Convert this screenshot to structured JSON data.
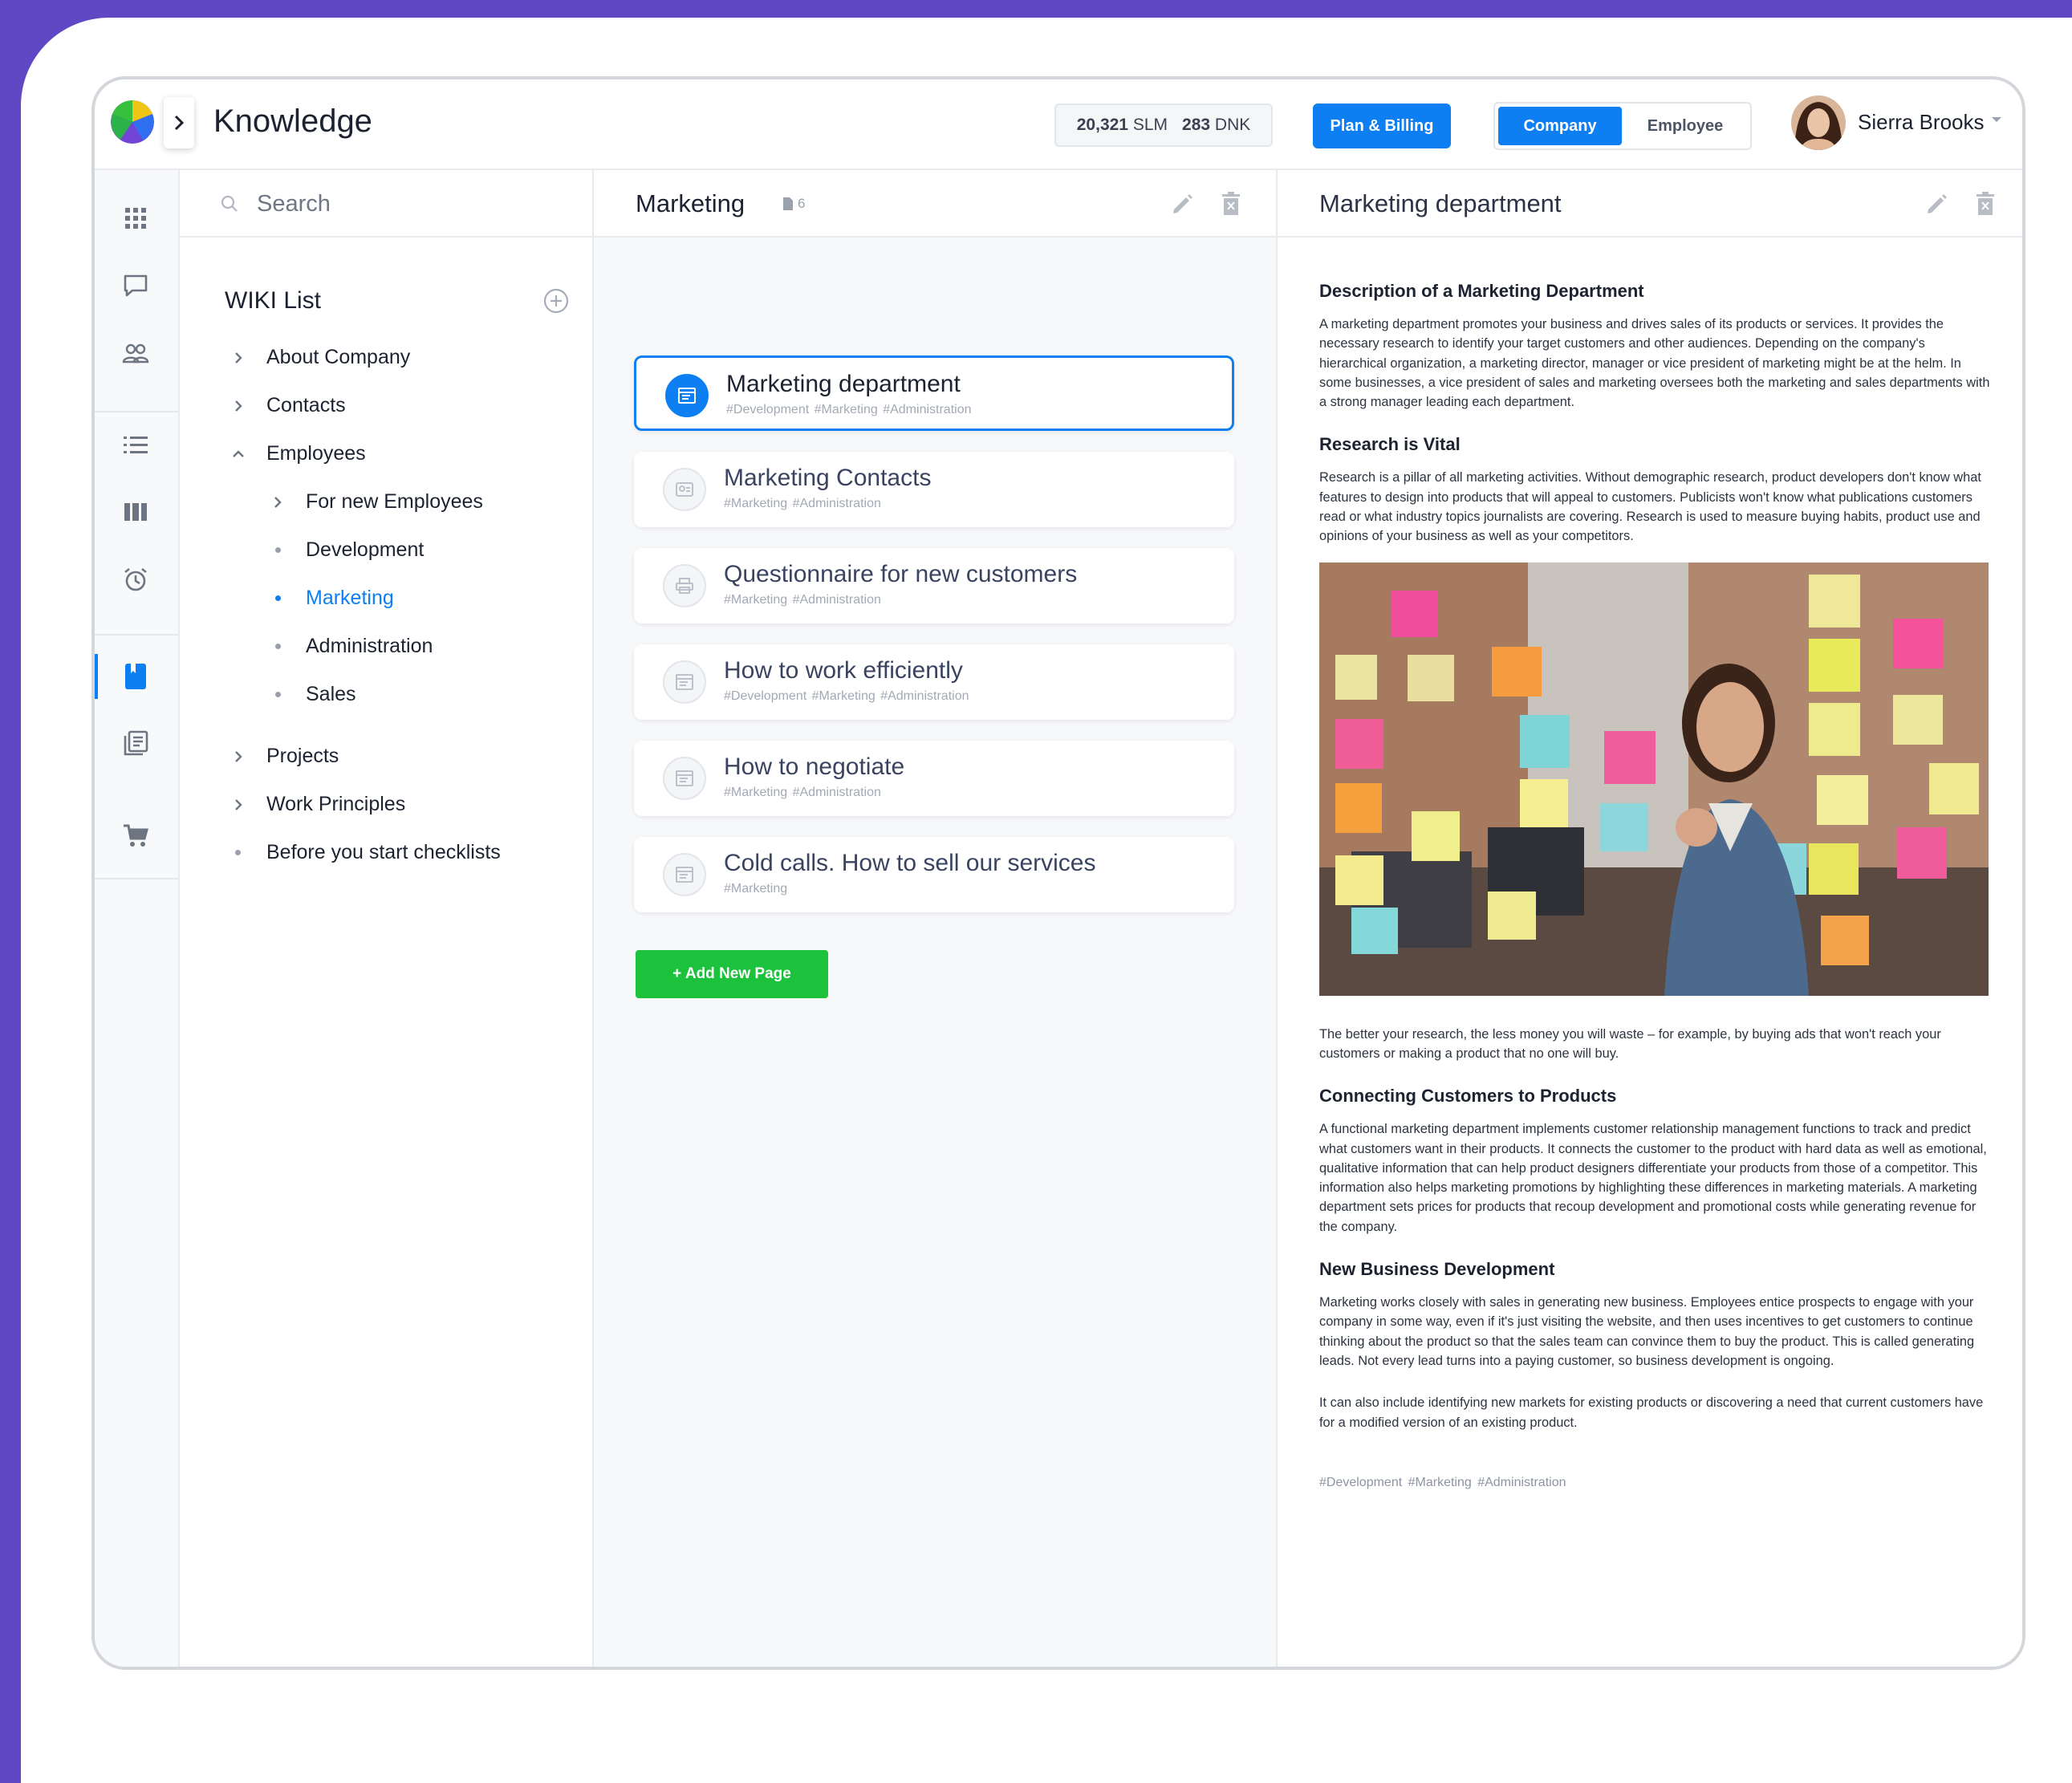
{
  "app": {
    "title": "Knowledge"
  },
  "header": {
    "balance_slm": "20,321",
    "balance_slm_unit": "SLM",
    "balance_dnk": "283",
    "balance_dnk_unit": "DNK",
    "plan_button": "Plan & Billing",
    "mode_toggle": {
      "active": "Company",
      "inactive": "Employee"
    },
    "user_name": "Sierra Brooks"
  },
  "rail": {
    "icons": [
      "apps-grid-icon",
      "chat-icon",
      "people-icon",
      "list-icon",
      "columns-icon",
      "alarm-clock-icon",
      "book-icon",
      "library-icon",
      "cart-icon"
    ],
    "active": "book-icon"
  },
  "wiki": {
    "search_placeholder": "Search",
    "heading": "WIKI List",
    "items": [
      {
        "label": "About Company",
        "type": "collapsed"
      },
      {
        "label": "Contacts",
        "type": "collapsed"
      },
      {
        "label": "Employees",
        "type": "expanded"
      },
      {
        "label": "For new Employees",
        "type": "collapsed"
      },
      {
        "label": "Development",
        "type": "leaf"
      },
      {
        "label": "Marketing",
        "type": "leaf",
        "selected": true
      },
      {
        "label": "Administration",
        "type": "leaf"
      },
      {
        "label": "Sales",
        "type": "leaf"
      },
      {
        "label": "Projects",
        "type": "collapsed"
      },
      {
        "label": "Work Principles",
        "type": "collapsed"
      },
      {
        "label": "Before you start checklists",
        "type": "leaf"
      }
    ]
  },
  "pages": {
    "title": "Marketing",
    "count": "6",
    "cards": [
      {
        "title": "Marketing department",
        "tags": "#Development #Marketing #Administration",
        "active": true
      },
      {
        "title": "Marketing Contacts",
        "tags": "#Marketing #Administration"
      },
      {
        "title": "Questionnaire for new customers",
        "tags": "#Marketing #Administration"
      },
      {
        "title": "How to work efficiently",
        "tags": "#Development #Marketing #Administration"
      },
      {
        "title": "How to negotiate",
        "tags": "#Marketing #Administration"
      },
      {
        "title": "Cold calls. How to sell our services",
        "tags": "#Marketing"
      }
    ],
    "add_button": "+ Add New Page"
  },
  "article": {
    "title": "Marketing department",
    "sections": [
      {
        "heading": "Description of a Marketing Department",
        "paragraphs": [
          "A marketing department promotes your business and drives sales of its products or services. It provides the necessary research to identify your target customers and other audiences. Depending on the company's hierarchical organization, a marketing director, manager or vice president of marketing might be at the helm. In some businesses, a vice president of sales and marketing oversees both the marketing and sales departments with a strong manager leading each department."
        ]
      },
      {
        "heading": "Research is Vital",
        "paragraphs": [
          "Research is a pillar of all marketing activities. Without demographic research, product developers don't know what features to design into products that will appeal to customers. Publicists won't know what publications customers read or what industry topics journalists are covering. Research is used to measure buying habits, product use and opinions of your business as well as your competitors.",
          "The better your research, the less money you will waste – for example, by buying ads that won't reach your customers or making a product that no one will buy."
        ]
      },
      {
        "heading": "Connecting Customers to Products",
        "paragraphs": [
          "A functional marketing department implements customer relationship management functions to track and predict what customers want in their products. It connects the customer to the product with hard data as well as emotional, qualitative information that can help product designers differentiate your products from those of a competitor. This information also helps marketing promotions by highlighting these differences in marketing materials. A marketing department sets prices for products that recoup development and promotional costs while generating revenue for the company."
        ]
      },
      {
        "heading": "New Business Development",
        "paragraphs": [
          "Marketing works closely with sales in generating new business. Employees entice prospects to engage with your company in some way, even if it's just visiting the website, and then uses incentives to get customers to continue thinking about the product so that the sales team can convince them to buy the product. This is called generating leads. Not every lead turns into a paying customer, so business development is ongoing.",
          "It can also include identifying new markets for existing products or discovering a need that current customers have for a modified version of an existing product."
        ]
      }
    ],
    "tags": "#Development #Marketing #Administration"
  },
  "colors": {
    "accent": "#0d7ff2",
    "success": "#1cc13c",
    "frame": "#6048c5"
  }
}
